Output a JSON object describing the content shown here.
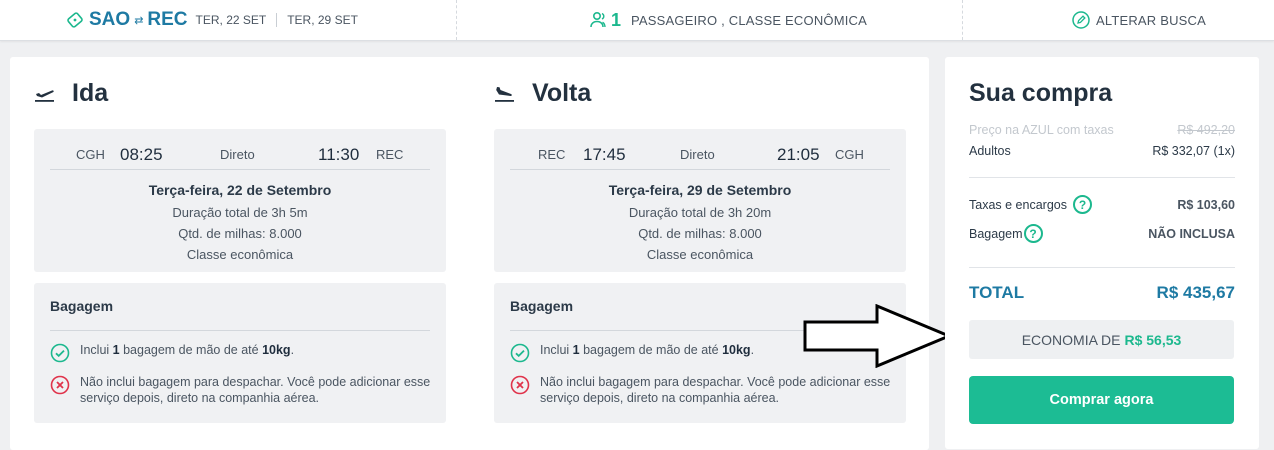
{
  "topbar": {
    "origin": "SAO",
    "destination": "REC",
    "date_out": "TER, 22 SET",
    "date_back": "TER, 29 SET",
    "pax_count": "1",
    "pax_text": "PASSAGEIRO , CLASSE ECONÔMICA",
    "alter_label": "ALTERAR BUSCA"
  },
  "ida": {
    "title": "Ida",
    "origin": "CGH",
    "depart": "08:25",
    "type": "Direto",
    "arrive": "11:30",
    "destination": "REC",
    "date": "Terça-feira, 22 de Setembro",
    "duration": "Duração total de 3h 5m",
    "miles": "Qtd. de milhas: 8.000",
    "cabin": "Classe econômica"
  },
  "volta": {
    "title": "Volta",
    "origin": "REC",
    "depart": "17:45",
    "type": "Direto",
    "arrive": "21:05",
    "destination": "CGH",
    "date": "Terça-feira, 29 de Setembro",
    "duration": "Duração total de 3h 20m",
    "miles": "Qtd. de milhas: 8.000",
    "cabin": "Classe econômica"
  },
  "baggage": {
    "title": "Bagagem",
    "inc_pre": "Inclui ",
    "inc_qty": "1",
    "inc_mid": " bagagem de mão de até ",
    "inc_weight": "10kg",
    "inc_end": ".",
    "exc_text": "Não inclui bagagem para despachar. Você pode adicionar esse serviço depois, direto na companhia aérea."
  },
  "summary": {
    "title": "Sua compra",
    "azul_label": "Preço na AZUL com taxas",
    "azul_price": "R$ 492,20",
    "adults_label": "Adultos",
    "adults_price": "R$ 332,07 (1x)",
    "taxes_label": "Taxas e encargos",
    "taxes_value": "R$ 103,60",
    "bag_label": "Bagagem",
    "bag_value": "NÃO INCLUSA",
    "total_label": "TOTAL",
    "total_value": "R$ 435,67",
    "econ_label": "ECONOMIA DE",
    "econ_value": "R$ 56,53",
    "buy_label": "Comprar agora",
    "help_glyph": "?"
  },
  "colors": {
    "accent_blue": "#1e7aa3",
    "accent_green": "#1cb88e",
    "danger_red": "#e0334b"
  }
}
